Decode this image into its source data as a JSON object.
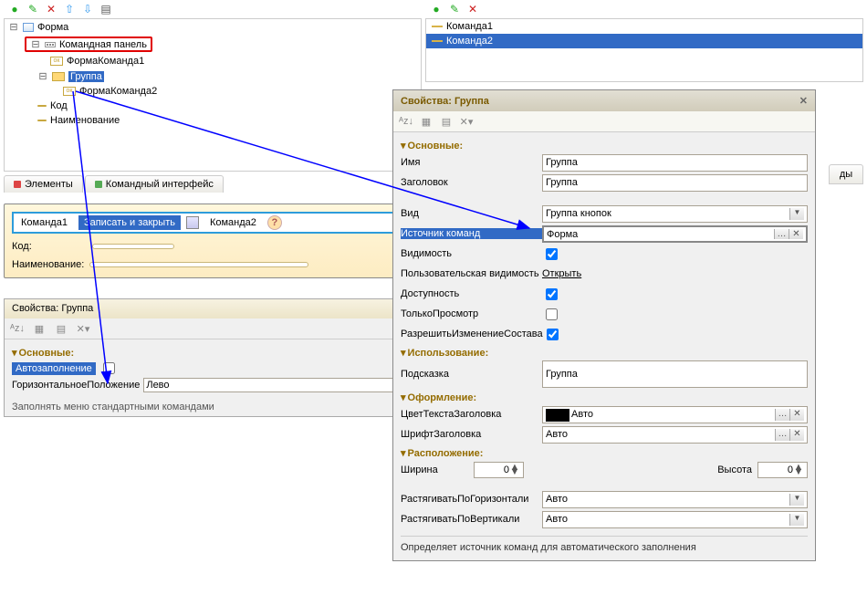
{
  "toolbar_icons": {
    "add": "+",
    "edit": "✎",
    "del": "✕",
    "up": "⬆",
    "down": "⬇",
    "menu": "≡"
  },
  "left_tree": {
    "root": "Форма",
    "cmd_panel": "Командная панель",
    "form_cmd1": "ФормаКоманда1",
    "group": "Группа",
    "form_cmd2": "ФормаКоманда2",
    "code": "Код",
    "name": "Наименование"
  },
  "tabs": {
    "elements": "Элементы",
    "cmd_iface": "Командный интерфейс"
  },
  "right_list": {
    "cmd1": "Команда1",
    "cmd2": "Команда2"
  },
  "preview": {
    "cmd1": "Команда1",
    "write_close": "Записать и закрыть",
    "cmd2": "Команда2",
    "code_lbl": "Код:",
    "name_lbl": "Наименование:"
  },
  "small": {
    "title": "Свойства: Группа",
    "main": "Основные:",
    "autofill": "Автозаполнение",
    "hpos": "ГоризонтальноеПоложение",
    "hpos_v": "Лево",
    "hint": "Заполнять меню стандартными командами"
  },
  "big": {
    "title": "Свойства: Группа",
    "sect_main": "Основные:",
    "name_lbl": "Имя",
    "name_v": "Группа",
    "title_lbl": "Заголовок",
    "title_v": "Группа",
    "kind_lbl": "Вид",
    "kind_v": "Группа кнопок",
    "src_lbl": "Источник команд",
    "src_v": "Форма",
    "vis_lbl": "Видимость",
    "uvis_lbl": "Пользовательская видимость",
    "uvis_v": "Открыть",
    "avail_lbl": "Доступность",
    "ro_lbl": "ТолькоПросмотр",
    "chcomp_lbl": "РазрешитьИзменениеСостава",
    "sect_use": "Использование:",
    "hint_lbl": "Подсказка",
    "hint_v": "Группа",
    "sect_decor": "Оформление:",
    "hcolor_lbl": "ЦветТекстаЗаголовка",
    "hcolor_v": "Авто",
    "hfont_lbl": "ШрифтЗаголовка",
    "hfont_v": "Авто",
    "sect_pos": "Расположение:",
    "w_lbl": "Ширина",
    "w_v": "0",
    "h_lbl": "Высота",
    "h_v": "0",
    "sh_lbl": "РастягиватьПоГоризонтали",
    "sh_v": "Авто",
    "sv_lbl": "РастягиватьПоВертикали",
    "sv_v": "Авто",
    "descr": "Определяет источник команд для автоматического заполнения"
  },
  "stub_tab": "ды"
}
